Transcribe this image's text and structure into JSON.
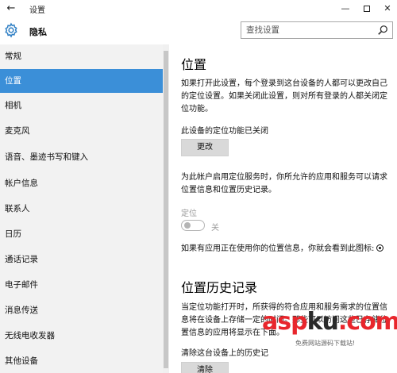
{
  "window": {
    "title": "设置",
    "back_glyph": "←",
    "minimize_glyph": "—",
    "close_glyph": "✕"
  },
  "header": {
    "section_title": "隐私",
    "search_placeholder": "查找设置"
  },
  "sidebar": {
    "items": [
      {
        "label": "常规",
        "active": false
      },
      {
        "label": "位置",
        "active": true
      },
      {
        "label": "相机",
        "active": false
      },
      {
        "label": "麦克风",
        "active": false
      },
      {
        "label": "语音、墨迹书写和键入",
        "active": false
      },
      {
        "label": "帐户信息",
        "active": false
      },
      {
        "label": "联系人",
        "active": false
      },
      {
        "label": "日历",
        "active": false
      },
      {
        "label": "通话记录",
        "active": false
      },
      {
        "label": "电子邮件",
        "active": false
      },
      {
        "label": "消息传送",
        "active": false
      },
      {
        "label": "无线电收发器",
        "active": false
      },
      {
        "label": "其他设备",
        "active": false
      }
    ]
  },
  "content": {
    "location": {
      "heading": "位置",
      "description_lines": [
        "如果打开此设置，每个登录到这台设备的人都可以更改自己",
        "的定位设置。如果关闭此设置，则对所有登录的人都关闭定",
        "位功能。"
      ],
      "device_status": "此设备的定位功能已关闭",
      "change_button": "更改",
      "account_text_lines": [
        "为此帐户启用定位服务时，你所允许的应用和服务可以请求",
        "位置信息和位置历史记录。"
      ],
      "toggle_label": "定位",
      "toggle_state": "关",
      "in_use_text": "如果有应用正在使用你的位置信息，你就会看到此图标:"
    },
    "history": {
      "heading": "位置历史记录",
      "description_lines": [
        "当定位功能打开时，所获得的符合应用和服务需求的位置信",
        "息将在设备上存储一定的时间。那些可以访问这些已存储位",
        "置信息的应用将显示在下面。"
      ],
      "clear_label": "清除这台设备上的历史记",
      "clear_button": "清除"
    }
  },
  "watermark": {
    "part1": "asp",
    "part2": "ku",
    "part3": ".com",
    "sub": "免费网站源码下载站!"
  },
  "colors": {
    "accent": "#3b8fd8",
    "sidebar_bg": "#f2f2f2",
    "button_bg": "#d9d9d9",
    "disabled": "#9a9a9a"
  }
}
